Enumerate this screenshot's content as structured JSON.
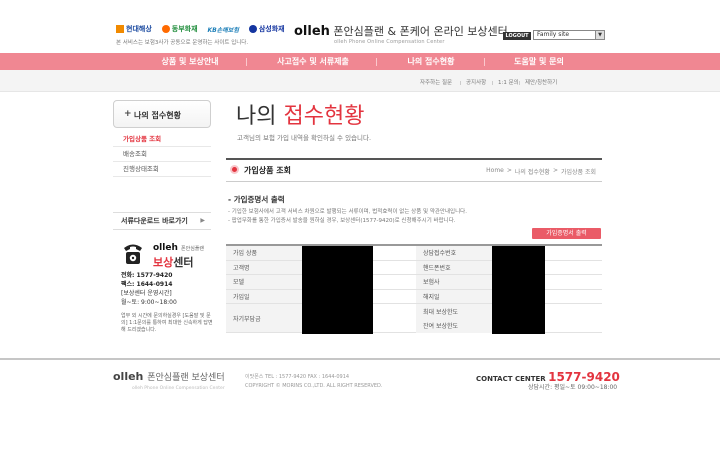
{
  "header": {
    "insurers": [
      {
        "name": "현대해상",
        "icon": "hyundai-logo-icon"
      },
      {
        "name": "동부화재",
        "icon": "dongbu-logo-icon"
      },
      {
        "name": "KB손해보험",
        "icon": "kb-logo-icon"
      },
      {
        "name": "삼성화재",
        "icon": "samsung-logo-icon"
      }
    ],
    "insurer_note": "본 서비스는 보험3사가 공동으로 운영하는 사이트 입니다.",
    "site_title_brand": "olleh",
    "site_title_text": "폰안심플랜 & 폰케어 온라인 보상센터",
    "site_subtitle": "olleh Phone Online Compensation Center",
    "logout_label": "LOGOUT",
    "family_site_label": "Family site"
  },
  "gnb": [
    "상품 및 보상안내",
    "사고접수 및 서류제출",
    "나의 접수현황",
    "도움말 및 문의"
  ],
  "lnb": [
    "자주하는 질문",
    "공지사항",
    "1:1 문의",
    "제안/칭찬하기"
  ],
  "sidebar": {
    "title": "나의 접수현황",
    "items": [
      "가입상품 조회",
      "배송조회",
      "진행상태조회"
    ],
    "download_label": "서류다운로드 바로가기",
    "center": {
      "brand": "olleh",
      "brand_sub": "폰안심플랜",
      "center_hl": "보상",
      "center_rest": "센터",
      "phone": "전화: 1577-9420",
      "fax": "팩스: 1644-0914",
      "hours_title": "[보상센터 운영시간]",
      "hours": "월~토: 9:00~18:00",
      "note": "업무 외 시간에 문의하실경우 [도움말 및 문의] 1:1문의를 통하여 최대한 신속하게 답변해 드리겠습니다."
    }
  },
  "content": {
    "title_plain": "나의 ",
    "title_hl": "접수현황",
    "desc": "고객님의 보험 가입 내역을 확인하실 수 있습니다.",
    "section_title": "가입상품 조회",
    "breadcrumb": [
      "Home",
      ">",
      "나의 접수현황",
      ">",
      "가입상품 조회"
    ],
    "cert_title": "- 가입증명서 출력",
    "cert_lines": [
      "- 기입한 보험사에서 고객 서비스 차원으로 발행되는 서류이며, 법적효력이 없는 상품 및 약관안내입니다.",
      "- 팝업무화를 통한 가입증서 발송을 원하실 경우, 보상센터(1577-9420)로 신청해주시기 바랍니다."
    ],
    "cert_button": "가입증명서 출력",
    "table": {
      "left_labels": [
        "가입 상품",
        "고객명",
        "모델",
        "가입일",
        "자기부담금"
      ],
      "right_labels": [
        "상담접수번호",
        "핸드폰번호",
        "보험사",
        "해지일",
        "최대 보상한도",
        "잔여 보상한도"
      ]
    }
  },
  "footer": {
    "logo_brand": "olleh",
    "logo_text": "폰안심플랜 보상센터",
    "logo_sub": "olleh Phone Online Compensation Center",
    "tel": "이맛폰스   TEL : 1577-9420     FAX : 1644-0914",
    "copyright": "COPYRIGHT © MORINS CO.,LTD. ALL RIGHT RESERVED.",
    "cc_label": "CONTACT CENTER",
    "cc_number": "1577-9420",
    "cc_hours": "상담시간: 평일~토 09:00~18:00"
  },
  "colors": {
    "accent": "#e3343f",
    "gnb": "#f08792"
  }
}
